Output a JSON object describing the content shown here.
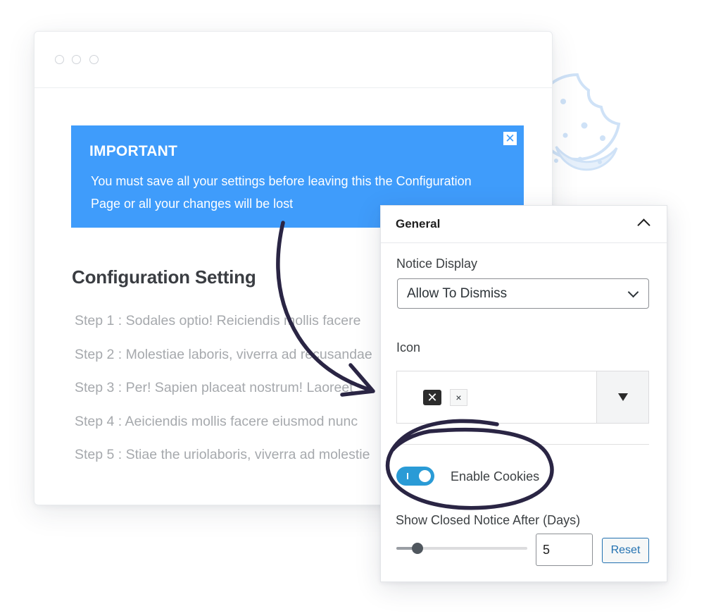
{
  "notice": {
    "title": "IMPORTANT",
    "line1": "You must save all your settings before leaving this the Configuration",
    "line2": "Page or all your changes will be lost",
    "close_icon": "close-icon",
    "color": "#3f9cfb"
  },
  "config": {
    "title": "Configuration Setting",
    "steps": [
      "Step 1 : Sodales optio! Reiciendis mollis facere",
      "Step 2 : Molestiae laboris, viverra ad recusandae",
      "Step 3 : Per! Sapien placeat nostrum! Laoreet",
      "Step 4 : Aeiciendis mollis facere eiusmod nunc",
      "Step 5 : Stiae the uriolaboris, viverra ad molestie"
    ]
  },
  "panel": {
    "title": "General",
    "notice_display": {
      "label": "Notice Display",
      "value": "Allow To Dismiss"
    },
    "icon_field": {
      "label": "Icon",
      "selected_icon": "close-icon",
      "remove_symbol": "×"
    },
    "cookies": {
      "label": "Enable Cookies",
      "enabled": true
    },
    "closed_notice": {
      "label": "Show Closed Notice After (Days)",
      "value": "5",
      "slider_fraction": 0.16,
      "reset_label": "Reset"
    }
  },
  "colors": {
    "notice_blue": "#3f9cfb",
    "toggle_blue": "#2a9bd6",
    "annotation_ink": "#2a2544",
    "cookie_outline": "#cfe2f7",
    "button_blue": "#2271b1"
  }
}
